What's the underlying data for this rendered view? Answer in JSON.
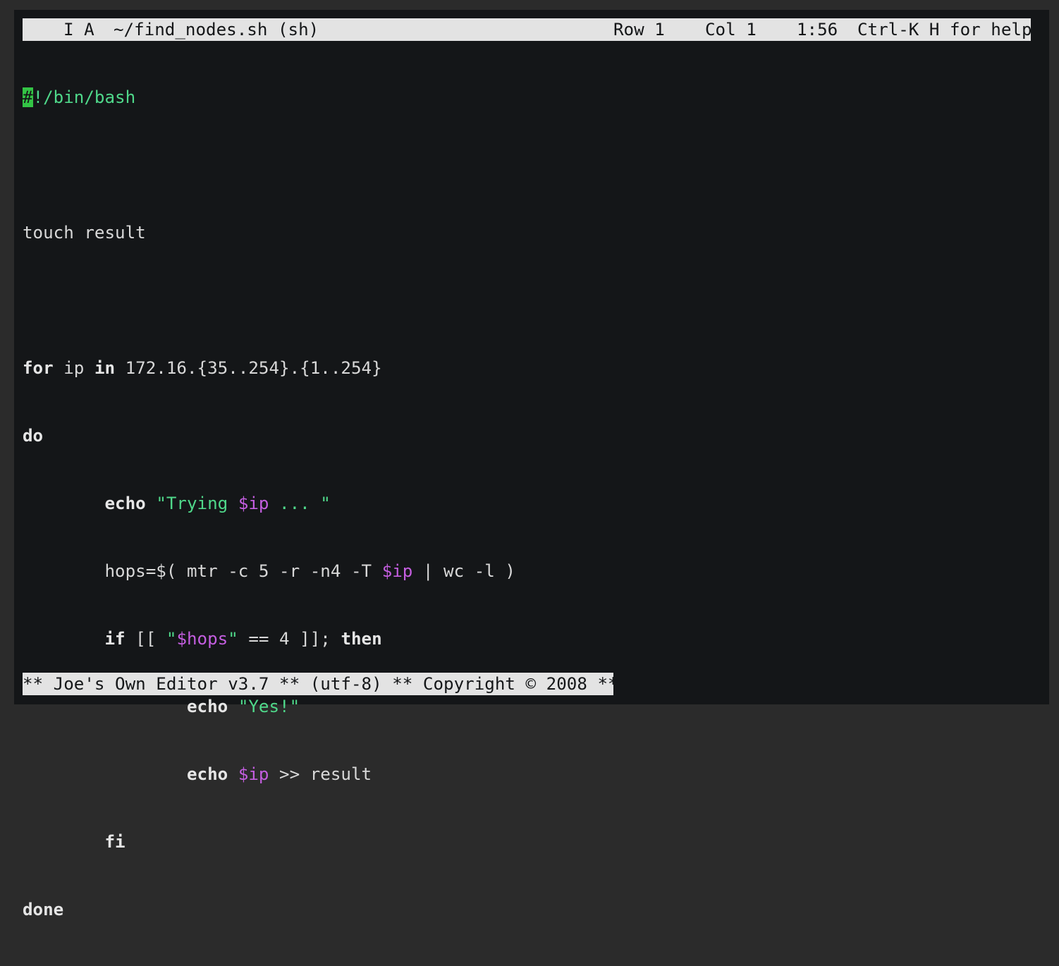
{
  "status": {
    "mode_flags": "I A",
    "filename": "~/find_nodes.sh (sh)",
    "row": "Row 1",
    "col": "Col 1",
    "time": "1:56",
    "help": "Ctrl-K H for help"
  },
  "code": {
    "line1_cursor": "#",
    "line1_rest": "!/bin/bash",
    "line3": "touch result",
    "line5_for": "for",
    "line5_mid": " ip ",
    "line5_in": "in",
    "line5_rest": " 172.16.{35..254}.{1..254}",
    "line6_do": "do",
    "line7_echo": "echo",
    "line7_str_a": "\"Trying ",
    "line7_var": "$ip",
    "line7_str_b": " ... \"",
    "line8_a": "hops=$( mtr -c 5 -r -n4 -T ",
    "line8_var": "$ip",
    "line8_b": " | wc -l )",
    "line9_if": "if",
    "line9_a": " [[ ",
    "line9_q1": "\"",
    "line9_var": "$hops",
    "line9_q2": "\"",
    "line9_b": " == 4 ]]; ",
    "line9_then": "then",
    "line10_echo": "echo",
    "line10_str": "\"Yes!\"",
    "line11_echo": "echo",
    "line11_var": "$ip",
    "line11_rest": " >> result",
    "line12_fi": "fi",
    "line13_done": "done"
  },
  "footer": {
    "text": "** Joe's Own Editor v3.7 ** (utf-8) ** Copyright © 2008 **"
  },
  "colors": {
    "background": "#141618",
    "status_bar": "#e3e3e3",
    "string": "#4fd88a",
    "variable": "#c45ee0",
    "cursor": "#33c445"
  }
}
